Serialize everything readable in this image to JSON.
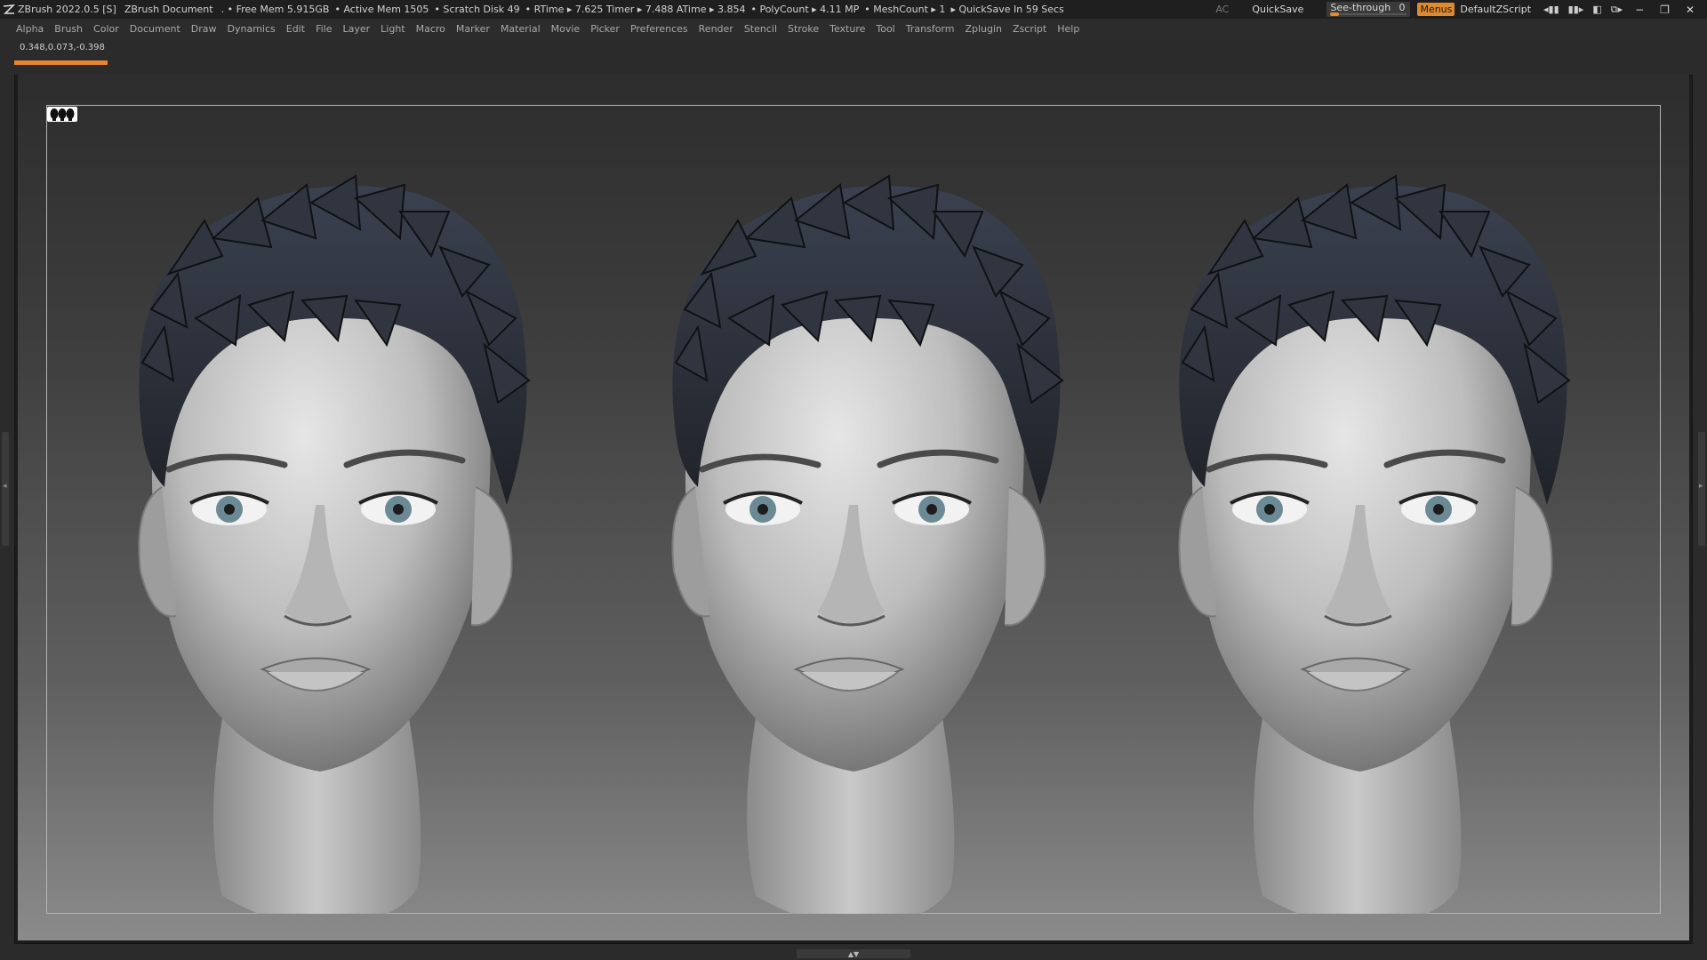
{
  "titlebar": {
    "app_version": "ZBrush 2022.0.5 [S]",
    "document": "ZBrush Document",
    "stats": [
      ". • Free Mem 5.915GB",
      "• Active Mem 1505",
      "• Scratch Disk 49",
      "• RTime ▸ 7.625 Timer ▸ 7.488 ATime ▸ 3.854",
      "• PolyCount ▸ 4.11 MP",
      "• MeshCount ▸ 1",
      "▸ QuickSave In 59 Secs"
    ],
    "ac_label": "AC",
    "quicksave_label": "QuickSave",
    "seethrough_label": "See-through",
    "seethrough_value": "0",
    "menus_label": "Menus",
    "script_label": "DefaultZScript"
  },
  "menubar": {
    "items": [
      "Alpha",
      "Brush",
      "Color",
      "Document",
      "Draw",
      "Dynamics",
      "Edit",
      "File",
      "Layer",
      "Light",
      "Macro",
      "Marker",
      "Material",
      "Movie",
      "Picker",
      "Preferences",
      "Render",
      "Stencil",
      "Stroke",
      "Texture",
      "Tool",
      "Transform",
      "Zplugin",
      "Zscript",
      "Help"
    ]
  },
  "status": {
    "coordinates": "0.348,0.073,-0.398",
    "progress": 0.07
  },
  "colors": {
    "accent": "#e8862a",
    "hair": "#2a2e36",
    "skin": "#c9c9c9"
  },
  "icons": {
    "app_logo": "zbrush-logo-icon",
    "perspective": "three-heads-icon"
  }
}
